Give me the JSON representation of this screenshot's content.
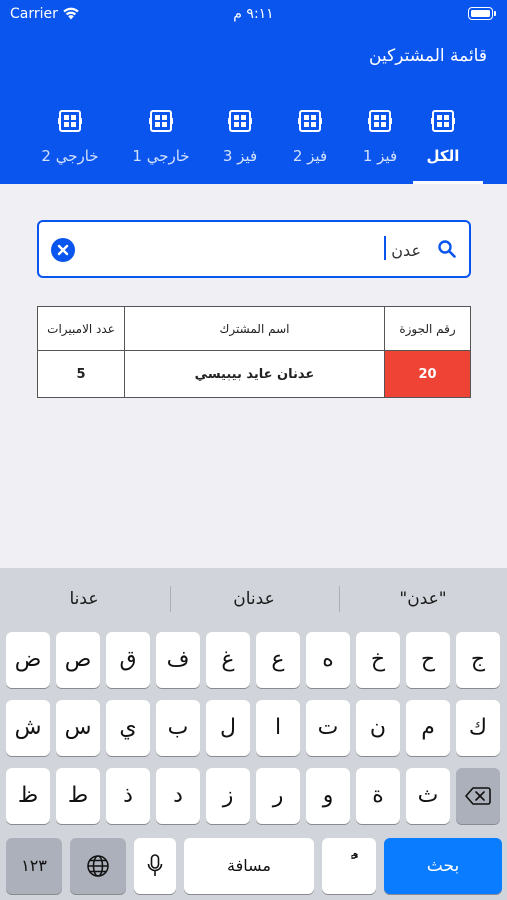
{
  "status_bar": {
    "carrier": "Carrier",
    "time": "٩:١١ م"
  },
  "header": {
    "title": "قائمة المشتركين"
  },
  "tabs": [
    {
      "label": "الكل",
      "active": true
    },
    {
      "label": "فيز 1",
      "active": false
    },
    {
      "label": "فيز 2",
      "active": false
    },
    {
      "label": "فيز 3",
      "active": false
    },
    {
      "label": "خارجي 1",
      "active": false
    },
    {
      "label": "خارجي 2",
      "active": false
    }
  ],
  "search": {
    "value": "عدن",
    "placeholder": ""
  },
  "table": {
    "headers": {
      "jawza": "رقم الجوزة",
      "name": "اسم المشترك",
      "amps": "عدد الامبيرات"
    },
    "rows": [
      {
        "jawza": "20",
        "name": "عدنان عايد بيبيسي",
        "amps": "5"
      }
    ]
  },
  "keyboard": {
    "suggestions": [
      "\"عدن\"",
      "عدنان",
      "عدنا"
    ],
    "row1": [
      "ض",
      "ص",
      "ق",
      "ف",
      "غ",
      "ع",
      "ه",
      "خ",
      "ح",
      "ج"
    ],
    "row2": [
      "ش",
      "س",
      "ي",
      "ب",
      "ل",
      "ا",
      "ت",
      "ن",
      "م",
      "ك"
    ],
    "row3": [
      "ظ",
      "ط",
      "ذ",
      "د",
      "ز",
      "ر",
      "و",
      "ة",
      "ث"
    ],
    "numbers_key": "١٢٣",
    "space_key": "مسافة",
    "diacritic_key": "ًٌ",
    "search_key": "بحث"
  },
  "colors": {
    "primary": "#0a55ee",
    "highlight": "#ef4335",
    "keyboard_bg": "#d1d4da",
    "search_key": "#0a7cff"
  }
}
